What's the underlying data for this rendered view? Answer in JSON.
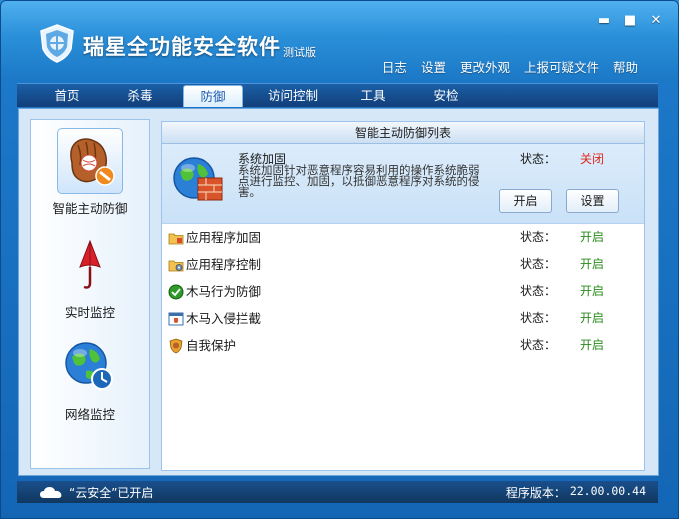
{
  "app": {
    "title": "瑞星全功能安全软件",
    "edition": "测试版"
  },
  "window_controls": {
    "minimize": "▬",
    "maximize": "■",
    "close": "✕"
  },
  "top_links": [
    "日志",
    "设置",
    "更改外观",
    "上报可疑文件",
    "帮助"
  ],
  "tabs": [
    {
      "label": "首页",
      "active": false
    },
    {
      "label": "杀毒",
      "active": false
    },
    {
      "label": "防御",
      "active": true
    },
    {
      "label": "访问控制",
      "active": false
    },
    {
      "label": "工具",
      "active": false
    },
    {
      "label": "安检",
      "active": false
    }
  ],
  "sidebar": {
    "items": [
      {
        "label": "智能主动防御",
        "icon": "baseball-glove-icon",
        "active": true
      },
      {
        "label": "实时监控",
        "icon": "umbrella-icon",
        "active": false
      },
      {
        "label": "网络监控",
        "icon": "globe-icon",
        "active": false
      }
    ]
  },
  "panel": {
    "header": "智能主动防御列表",
    "feature": {
      "title": "系统加固",
      "description": "系统加固针对恶意程序容易利用的操作系统脆弱点进行监控、加固，以抵御恶意程序对系统的侵害。",
      "status_label": "状态：",
      "status_value": "关闭",
      "enable_button": "开启",
      "settings_button": "设置"
    },
    "rows": [
      {
        "label": "应用程序加固",
        "icon": "folder-lock-icon",
        "status_label": "状态：",
        "status_value": "开启"
      },
      {
        "label": "应用程序控制",
        "icon": "folder-gear-icon",
        "status_label": "状态：",
        "status_value": "开启"
      },
      {
        "label": "木马行为防御",
        "icon": "green-orb-icon",
        "status_label": "状态：",
        "status_value": "开启"
      },
      {
        "label": "木马入侵拦截",
        "icon": "window-shield-icon",
        "status_label": "状态：",
        "status_value": "开启"
      },
      {
        "label": "自我保护",
        "icon": "lion-shield-icon",
        "status_label": "状态：",
        "status_value": "开启"
      }
    ]
  },
  "statusbar": {
    "cloud_text": "“云安全”已开启",
    "version_label": "程序版本：",
    "version_value": "22.00.00.44"
  },
  "colors": {
    "status_on": "#2a8b1c",
    "status_off": "#e2261b",
    "frame_blue": "#1c78c9"
  }
}
